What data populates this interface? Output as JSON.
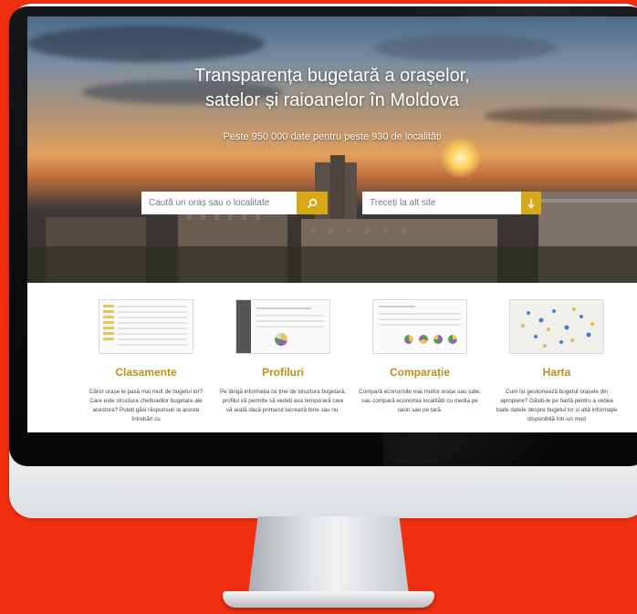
{
  "hero": {
    "title_line1": "Transparența bugetară a orașelor,",
    "title_line2": "satelor și raioanelor în Moldova",
    "subtitle": "Peste 950 000 date pentru peste 930 de localități"
  },
  "search": {
    "placeholder": "Caută un oraș sau o localitate",
    "icon": "search-icon"
  },
  "site_switch": {
    "placeholder": "Treceți la alt site",
    "icon": "arrow-down-icon"
  },
  "features": [
    {
      "title": "Clasamente",
      "text": "Căror orașe le pasă mai mult de bugetul lor? Care este structura cheltuielilor bugetare ale acestora? Puteți găsi răspunsuri la aceste întrebări cu"
    },
    {
      "title": "Profiluri",
      "text": "Pe lângă informația ce ține de structura bugetară, profilul vă permite să vedeți axa temporară care vă arată dacă primarul lucrează bine sau nu."
    },
    {
      "title": "Comparație",
      "text": "Compară economiile mai multor orașe sau sate, sau compară economia localității cu media pe raion sau pe țară."
    },
    {
      "title": "Harta",
      "text": "Cum își gestionează bugetul orașele din apropiere? Găsiți-le pe hartă pentru a vedea toate datele despre bugetul lor și altă informație disponibilă într-un mod"
    }
  ],
  "colors": {
    "accent": "#d7a817",
    "background": "#ef2f10",
    "heading": "#b8901c"
  }
}
